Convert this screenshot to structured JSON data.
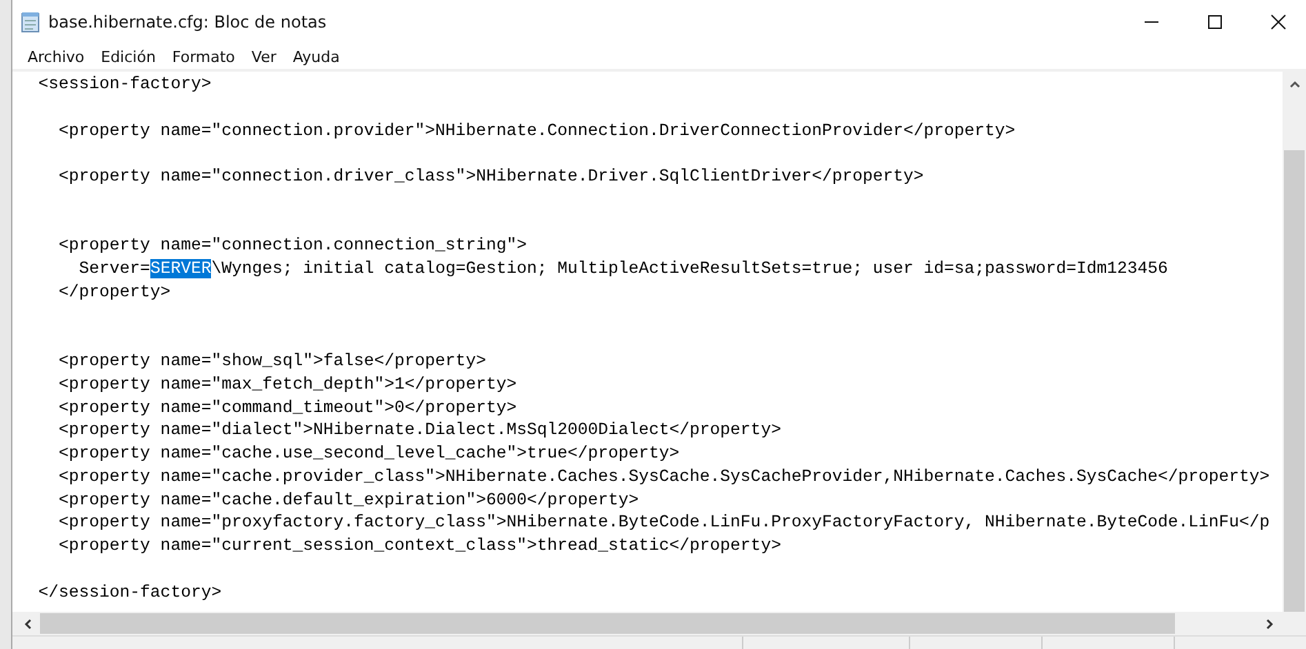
{
  "window": {
    "title": "base.hibernate.cfg: Bloc de notas"
  },
  "menu": [
    "Archivo",
    "Edición",
    "Formato",
    "Ver",
    "Ayuda"
  ],
  "lines": [
    {
      "kind": "text",
      "text": "  <session-factory>"
    },
    {
      "kind": "blank"
    },
    {
      "kind": "text",
      "text": "    <property name=\"connection.provider\">NHibernate.Connection.DriverConnectionProvider</property>"
    },
    {
      "kind": "blank"
    },
    {
      "kind": "text",
      "text": "    <property name=\"connection.driver_class\">NHibernate.Driver.SqlClientDriver</property>"
    },
    {
      "kind": "blank"
    },
    {
      "kind": "blank"
    },
    {
      "kind": "text",
      "text": "    <property name=\"connection.connection_string\">"
    },
    {
      "kind": "selection",
      "before": "      Server=",
      "selected": "SERVER",
      "after": "\\Wynges; initial catalog=Gestion; MultipleActiveResultSets=true; user id=sa;password=Idm123456"
    },
    {
      "kind": "text",
      "text": "    </property>"
    },
    {
      "kind": "blank"
    },
    {
      "kind": "blank"
    },
    {
      "kind": "text",
      "text": "    <property name=\"show_sql\">false</property>"
    },
    {
      "kind": "text",
      "text": "    <property name=\"max_fetch_depth\">1</property>"
    },
    {
      "kind": "text",
      "text": "    <property name=\"command_timeout\">0</property>"
    },
    {
      "kind": "text",
      "text": "    <property name=\"dialect\">NHibernate.Dialect.MsSql2000Dialect</property>"
    },
    {
      "kind": "text",
      "text": "    <property name=\"cache.use_second_level_cache\">true</property>"
    },
    {
      "kind": "text",
      "text": "    <property name=\"cache.provider_class\">NHibernate.Caches.SysCache.SysCacheProvider,NHibernate.Caches.SysCache</property>"
    },
    {
      "kind": "text",
      "text": "    <property name=\"cache.default_expiration\">6000</property>"
    },
    {
      "kind": "text",
      "text": "    <property name=\"proxyfactory.factory_class\">NHibernate.ByteCode.LinFu.ProxyFactoryFactory, NHibernate.ByteCode.LinFu</p"
    },
    {
      "kind": "text",
      "text": "    <property name=\"current_session_context_class\">thread_static</property>"
    },
    {
      "kind": "blank"
    },
    {
      "kind": "text",
      "text": "  </session-factory>"
    }
  ]
}
